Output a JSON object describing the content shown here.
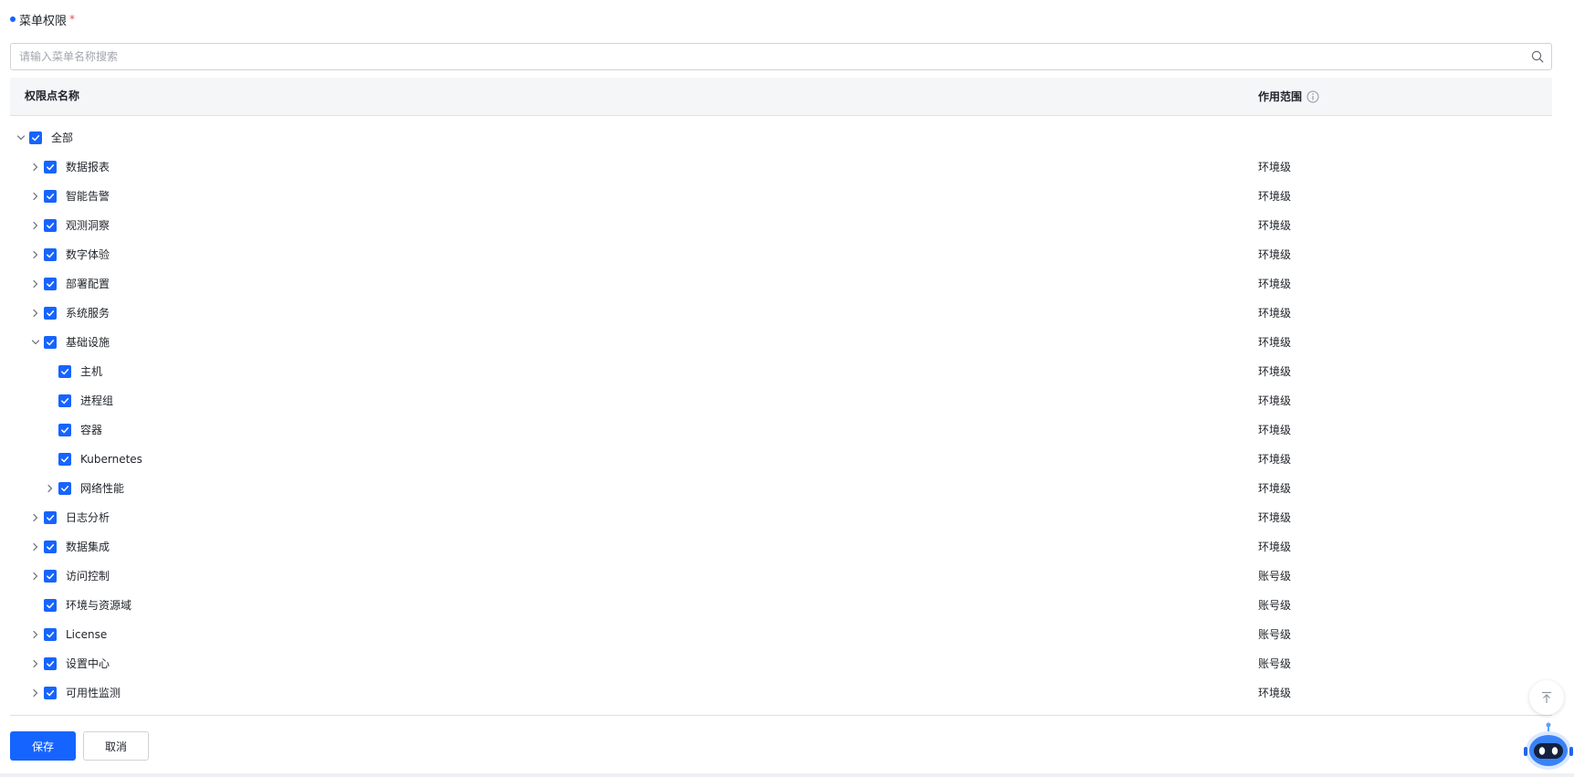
{
  "section": {
    "title": "菜单权限",
    "required_mark": "*"
  },
  "search": {
    "placeholder": "请输入菜单名称搜索",
    "value": ""
  },
  "table": {
    "headers": {
      "name": "权限点名称",
      "scope": "作用范围"
    },
    "rows": [
      {
        "label": "全部",
        "scope": "",
        "level": 0,
        "expander": "expanded",
        "checked": true
      },
      {
        "label": "数据报表",
        "scope": "环境级",
        "level": 1,
        "expander": "collapsed",
        "checked": true
      },
      {
        "label": "智能告警",
        "scope": "环境级",
        "level": 1,
        "expander": "collapsed",
        "checked": true
      },
      {
        "label": "观测洞察",
        "scope": "环境级",
        "level": 1,
        "expander": "collapsed",
        "checked": true
      },
      {
        "label": "数字体验",
        "scope": "环境级",
        "level": 1,
        "expander": "collapsed",
        "checked": true
      },
      {
        "label": "部署配置",
        "scope": "环境级",
        "level": 1,
        "expander": "collapsed",
        "checked": true
      },
      {
        "label": "系统服务",
        "scope": "环境级",
        "level": 1,
        "expander": "collapsed",
        "checked": true
      },
      {
        "label": "基础设施",
        "scope": "环境级",
        "level": 1,
        "expander": "expanded",
        "checked": true
      },
      {
        "label": "主机",
        "scope": "环境级",
        "level": 2,
        "expander": "none",
        "checked": true
      },
      {
        "label": "进程组",
        "scope": "环境级",
        "level": 2,
        "expander": "none",
        "checked": true
      },
      {
        "label": "容器",
        "scope": "环境级",
        "level": 2,
        "expander": "none",
        "checked": true
      },
      {
        "label": "Kubernetes",
        "scope": "环境级",
        "level": 2,
        "expander": "none",
        "checked": true
      },
      {
        "label": "网络性能",
        "scope": "环境级",
        "level": 2,
        "expander": "collapsed",
        "checked": true
      },
      {
        "label": "日志分析",
        "scope": "环境级",
        "level": 1,
        "expander": "collapsed",
        "checked": true
      },
      {
        "label": "数据集成",
        "scope": "环境级",
        "level": 1,
        "expander": "collapsed",
        "checked": true
      },
      {
        "label": "访问控制",
        "scope": "账号级",
        "level": 1,
        "expander": "collapsed",
        "checked": true
      },
      {
        "label": "环境与资源域",
        "scope": "账号级",
        "level": 1,
        "expander": "none",
        "checked": true
      },
      {
        "label": "License",
        "scope": "账号级",
        "level": 1,
        "expander": "collapsed",
        "checked": true
      },
      {
        "label": "设置中心",
        "scope": "账号级",
        "level": 1,
        "expander": "collapsed",
        "checked": true
      },
      {
        "label": "可用性监测",
        "scope": "环境级",
        "level": 1,
        "expander": "collapsed",
        "checked": true
      }
    ]
  },
  "footer": {
    "save_label": "保存",
    "cancel_label": "取消"
  },
  "icons": {
    "search": "search-icon",
    "info": "info-icon",
    "chevron_right": "chevron-right-icon",
    "chevron_down": "chevron-down-icon",
    "check": "check-icon",
    "back_to_top": "back-to-top-icon",
    "assistant": "robot-assistant-icon"
  },
  "colors": {
    "primary": "#1664ff",
    "required": "#f54a45",
    "header_bg": "#f5f6f8",
    "border": "#dee0e3"
  }
}
